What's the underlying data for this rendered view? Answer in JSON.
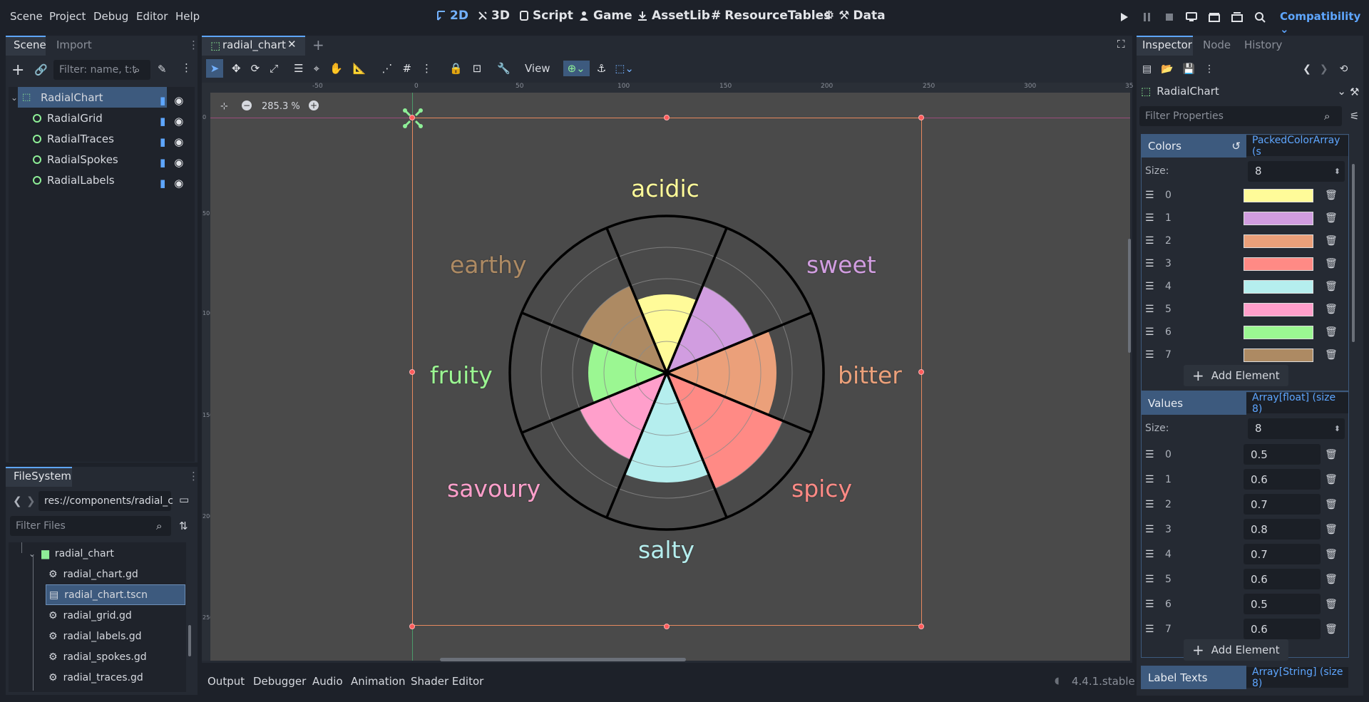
{
  "menu": [
    "Scene",
    "Project",
    "Debug",
    "Editor",
    "Help"
  ],
  "workspaces": [
    {
      "label": "2D",
      "icon": "2d-icon",
      "active": true
    },
    {
      "label": "3D",
      "icon": "3d-icon",
      "active": false
    },
    {
      "label": "Script",
      "icon": "script-icon",
      "active": false
    },
    {
      "label": "Game",
      "icon": "game-icon",
      "active": false
    },
    {
      "label": "AssetLib",
      "icon": "assetlib-icon",
      "active": false
    },
    {
      "label": "ResourceTables",
      "icon": "hash-icon",
      "active": false
    },
    {
      "label": "Data",
      "icon": "gear-icon",
      "active": false
    }
  ],
  "renderer": "Compatibility",
  "scene_panel": {
    "tabs": [
      "Scene",
      "Import"
    ],
    "filter_placeholder": "Filter: name, t:t",
    "nodes": [
      "RadialChart",
      "RadialGrid",
      "RadialTraces",
      "RadialSpokes",
      "RadialLabels"
    ]
  },
  "filesystem": {
    "tab": "FileSystem",
    "path": "res://components/radial_c",
    "filter_placeholder": "Filter Files",
    "folder": "radial_chart",
    "files": [
      "radial_chart.gd",
      "radial_chart.tscn",
      "radial_grid.gd",
      "radial_labels.gd",
      "radial_spokes.gd",
      "radial_traces.gd"
    ],
    "selected": "radial_chart.tscn"
  },
  "editor": {
    "tab": "radial_chart",
    "view_label": "View",
    "zoom": "285.3 %",
    "ruler_h": [
      "-50",
      "0",
      "50",
      "100",
      "150",
      "200",
      "250",
      "300",
      "35"
    ],
    "ruler_v": [
      "0",
      "50",
      "100",
      "150",
      "200",
      "250"
    ]
  },
  "chart_data": {
    "type": "radial",
    "categories": [
      "acidic",
      "sweet",
      "bitter",
      "spicy",
      "salty",
      "savoury",
      "fruity",
      "earthy"
    ],
    "values": [
      0.5,
      0.6,
      0.7,
      0.8,
      0.7,
      0.6,
      0.5,
      0.6
    ],
    "colors": [
      "#fffb99",
      "#d19de0",
      "#eba07a",
      "#ff8a85",
      "#b5eeee",
      "#ff9fcb",
      "#9bf792",
      "#ad8a63"
    ],
    "rlim": [
      0,
      1
    ],
    "rings": [
      0.2,
      0.4,
      0.6,
      0.8
    ]
  },
  "bottom_tabs": [
    "Output",
    "Debugger",
    "Audio",
    "Animation",
    "Shader Editor"
  ],
  "version": "4.4.1.stable",
  "inspector": {
    "tabs": [
      "Inspector",
      "Node",
      "History"
    ],
    "object": "RadialChart",
    "filter_placeholder": "Filter Properties",
    "colors_prop": {
      "label": "Colors",
      "type": "PackedColorArray (s",
      "size_label": "Size:",
      "size": "8",
      "indices": [
        "0",
        "1",
        "2",
        "3",
        "4",
        "5",
        "6",
        "7"
      ]
    },
    "values_prop": {
      "label": "Values",
      "type": "Array[float] (size 8)",
      "size_label": "Size:",
      "size": "8",
      "indices": [
        "0",
        "1",
        "2",
        "3",
        "4",
        "5",
        "6",
        "7"
      ],
      "entries": [
        "0.5",
        "0.6",
        "0.7",
        "0.8",
        "0.7",
        "0.6",
        "0.5",
        "0.6"
      ]
    },
    "add_element": "Add Element",
    "label_texts": {
      "label": "Label Texts",
      "type": "Array[String] (size 8)"
    }
  }
}
